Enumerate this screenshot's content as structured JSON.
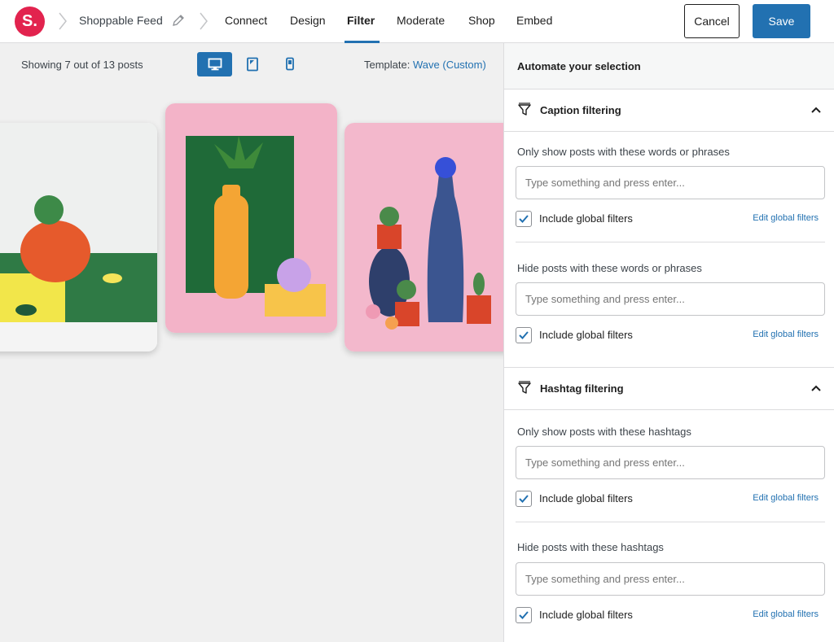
{
  "brand": {
    "logo_text": "S.",
    "accent": "#2271b1",
    "logo_color": "#e2234e"
  },
  "header": {
    "feed_name": "Shoppable Feed",
    "tabs": [
      {
        "label": "Connect",
        "active": false
      },
      {
        "label": "Design",
        "active": false
      },
      {
        "label": "Filter",
        "active": true
      },
      {
        "label": "Moderate",
        "active": false
      },
      {
        "label": "Shop",
        "active": false
      },
      {
        "label": "Embed",
        "active": false
      }
    ],
    "cancel_label": "Cancel",
    "save_label": "Save"
  },
  "preview": {
    "showing_text": "Showing 7 out of 13 posts",
    "devices": [
      {
        "name": "desktop-icon",
        "active": true
      },
      {
        "name": "tablet-icon",
        "active": false
      },
      {
        "name": "mobile-icon",
        "active": false
      }
    ],
    "template_label": "Template:",
    "template_value": "Wave (Custom)"
  },
  "panel": {
    "title": "Automate your selection",
    "caption": {
      "title": "Caption filtering",
      "only_show_label": "Only show posts with these words or phrases",
      "hide_label": "Hide posts with these words or phrases",
      "placeholder": "Type something and press enter...",
      "include_global": "Include global filters",
      "edit_global": "Edit global filters",
      "only_show_include_checked": true,
      "hide_include_checked": true
    },
    "hashtag": {
      "title": "Hashtag filtering",
      "only_show_label": "Only show posts with these hashtags",
      "hide_label": "Hide posts with these hashtags",
      "placeholder": "Type something and press enter...",
      "include_global": "Include global filters",
      "edit_global": "Edit global filters",
      "only_show_include_checked": true,
      "hide_include_checked": true
    }
  }
}
